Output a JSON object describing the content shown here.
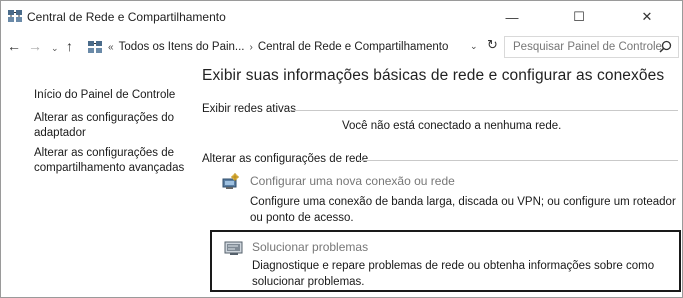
{
  "window": {
    "title": "Central de Rede e Compartilhamento",
    "controls": {
      "minimize": "—",
      "maximize": "☐",
      "close": "✕"
    }
  },
  "address_bar": {
    "back": "←",
    "forward": "→",
    "recent": "⌄",
    "up": "↑",
    "overflow": "«",
    "breadcrumbs": [
      "Todos os Itens do Pain...",
      "Central de Rede e Compartilhamento"
    ],
    "separator": "›",
    "dropdown": "⌄",
    "refresh": "↻",
    "search_placeholder": "Pesquisar Painel de Controle"
  },
  "sidebar": {
    "items": [
      {
        "label": "Início do Painel de Controle"
      },
      {
        "label": "Alterar as configurações do adaptador"
      },
      {
        "label": "Alterar as configurações de compartilhamento avançadas"
      }
    ]
  },
  "main": {
    "heading": "Exibir suas informações básicas de rede e configurar as conexões",
    "active_networks": {
      "label": "Exibir redes ativas",
      "status": "Você não está conectado a nenhuma rede."
    },
    "change_settings": {
      "label": "Alterar as configurações de rede",
      "tasks": [
        {
          "icon": "new-connection-icon",
          "title": "Configurar uma nova conexão ou rede",
          "description": "Configure uma conexão de banda larga, discada ou VPN; ou configure um roteador ou ponto de acesso."
        },
        {
          "icon": "troubleshoot-icon",
          "title": "Solucionar problemas",
          "description": "Diagnostique e repare problemas de rede ou obtenha informações sobre como solucionar problemas."
        }
      ]
    }
  },
  "colors": {
    "link_muted": "#777777",
    "rule": "#c9c9c9",
    "highlight_border": "#1a1a1a"
  }
}
